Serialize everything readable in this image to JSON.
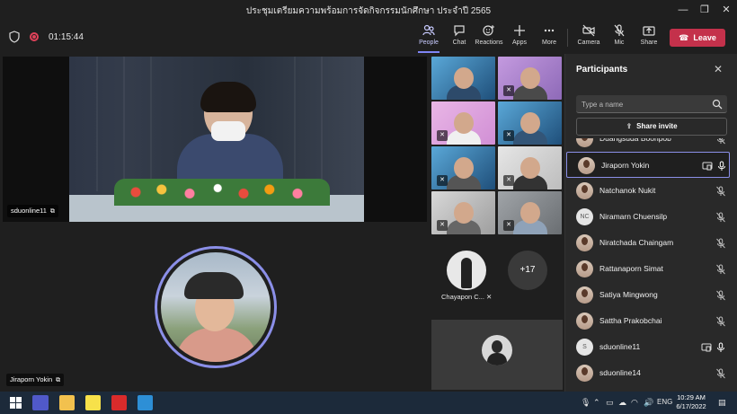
{
  "window": {
    "title": "ประชุมเตรียมความพร้อมการจัดกิจกรรมนักศึกษา ประจำปี 2565",
    "minimize": "—",
    "maximize": "❐",
    "close": "✕"
  },
  "toolbar": {
    "timer": "01:15:44",
    "buttons": {
      "people": "People",
      "chat": "Chat",
      "reactions": "Reactions",
      "apps": "Apps",
      "more": "More",
      "camera": "Camera",
      "mic": "Mic",
      "share": "Share"
    },
    "leave": "Leave",
    "accent": "#7f85f5",
    "leave_color": "#c4314b"
  },
  "stage": {
    "main_video_name": "sduonline11",
    "spotlight_name": "Jiraporn Yokin",
    "gallery_tiles": 8,
    "chayapon_name": "Chayapon C...",
    "more_count": "+17"
  },
  "participants": {
    "title": "Participants",
    "search_placeholder": "Type a name",
    "share_invite": "Share invite",
    "list": [
      {
        "name": "Duangsuda Boonpob",
        "avatar": "photo",
        "initials": "",
        "icons": [
          "mic-off"
        ]
      },
      {
        "name": "Jiraporn Yokin",
        "avatar": "photo",
        "initials": "",
        "icons": [
          "screen-share",
          "mic-on"
        ],
        "selected": true
      },
      {
        "name": "Natchanok Nukit",
        "avatar": "photo",
        "initials": "",
        "icons": [
          "mic-off"
        ]
      },
      {
        "name": "Niramarn Chuensilp",
        "avatar": "initials",
        "initials": "NC",
        "icons": [
          "mic-off"
        ]
      },
      {
        "name": "Niratchada Chaingam",
        "avatar": "photo",
        "initials": "",
        "icons": [
          "mic-off"
        ]
      },
      {
        "name": "Rattanaporn Simat",
        "avatar": "photo",
        "initials": "",
        "icons": [
          "mic-off"
        ]
      },
      {
        "name": "Satiya Mingwong",
        "avatar": "photo",
        "initials": "",
        "icons": [
          "mic-off"
        ]
      },
      {
        "name": "Sattha Prakobchai",
        "avatar": "photo",
        "initials": "",
        "icons": [
          "mic-off"
        ]
      },
      {
        "name": "sduonline11",
        "avatar": "initials",
        "initials": "S",
        "icons": [
          "screen-share",
          "mic-on"
        ]
      },
      {
        "name": "sduonline14",
        "avatar": "photo",
        "initials": "",
        "icons": [
          "mic-off"
        ]
      }
    ]
  },
  "taskbar": {
    "apps": [
      "windows-start-icon",
      "teams-icon",
      "file-explorer-icon",
      "sticky-notes-icon",
      "acrobat-icon",
      "photos-icon"
    ],
    "language": "ENG",
    "time": "10:29 AM",
    "date": "6/17/2022"
  }
}
